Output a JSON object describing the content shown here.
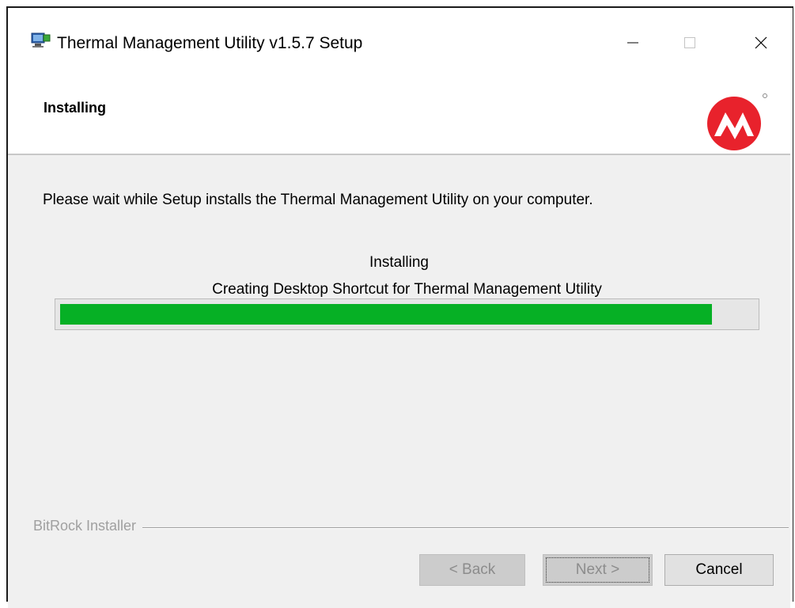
{
  "window": {
    "title": "Thermal Management Utility v1.5.7 Setup"
  },
  "header": {
    "title": "Installing",
    "logo_icon": "microchip-logo-icon",
    "logo_color": "#e8222c"
  },
  "main": {
    "description": "Please wait while Setup installs the Thermal Management Utility on your computer.",
    "status_title": "Installing",
    "status_detail": "Creating Desktop Shortcut for Thermal Management Utility",
    "progress_fraction": 0.94,
    "progress_color": "#06b025"
  },
  "footer": {
    "branding": "BitRock Installer",
    "back_label": "< Back",
    "next_label": "Next >",
    "cancel_label": "Cancel"
  }
}
